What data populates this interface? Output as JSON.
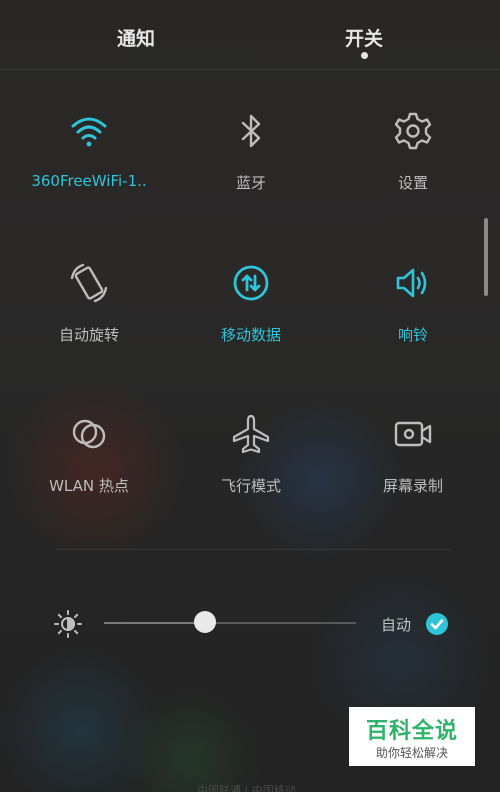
{
  "tabs": [
    {
      "label": "通知",
      "active": false
    },
    {
      "label": "开关",
      "active": true
    }
  ],
  "tiles": [
    {
      "label": "360FreeWiFi-1..",
      "icon": "wifi-icon",
      "active": true
    },
    {
      "label": "蓝牙",
      "icon": "bluetooth-icon",
      "active": false
    },
    {
      "label": "设置",
      "icon": "gear-icon",
      "active": false
    },
    {
      "label": "自动旋转",
      "icon": "auto-rotate-icon",
      "active": false
    },
    {
      "label": "移动数据",
      "icon": "mobile-data-icon",
      "active": true
    },
    {
      "label": "响铃",
      "icon": "speaker-icon",
      "active": true
    },
    {
      "label": "WLAN 热点",
      "icon": "hotspot-icon",
      "active": false
    },
    {
      "label": "飞行模式",
      "icon": "airplane-icon",
      "active": false
    },
    {
      "label": "屏幕录制",
      "icon": "screen-record-icon",
      "active": false
    }
  ],
  "brightness": {
    "level": 0.4,
    "auto_label": "自动",
    "auto_enabled": true
  },
  "watermark": {
    "title": "百科全说",
    "subtitle": "助你轻松解决"
  },
  "carrier_text": "中国联通 | 中国移动",
  "colors": {
    "accent": "#2fc4d8",
    "inactive": "#bdbdbd",
    "background": "#2b2a29",
    "watermark_green": "#2fb36a"
  }
}
